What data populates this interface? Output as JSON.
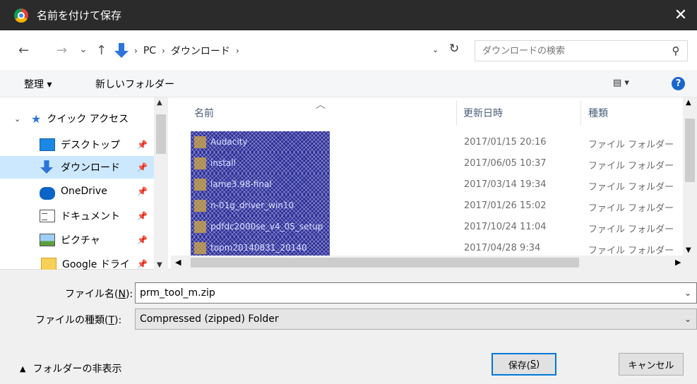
{
  "window": {
    "title": "名前を付けて保存",
    "close_label": "✕"
  },
  "nav": {
    "back": "←",
    "forward": "→",
    "recent": "⌄",
    "up": "↑",
    "breadcrumb": [
      "PC",
      "ダウンロード"
    ],
    "refresh": "↻",
    "search_placeholder": "ダウンロードの検索"
  },
  "toolbar": {
    "organize_label": "整理 ▾",
    "new_folder_label": "新しいフォルダー",
    "view_label": "▤ ▾",
    "help_label": "?"
  },
  "sidebar": {
    "items": [
      {
        "label": "クイック アクセス",
        "icon": "star-icon"
      },
      {
        "label": "デスクトップ",
        "icon": "desktop-icon"
      },
      {
        "label": "ダウンロード",
        "icon": "download-icon",
        "selected": true
      },
      {
        "label": "OneDrive",
        "icon": "onedrive-icon"
      },
      {
        "label": "ドキュメント",
        "icon": "document-icon"
      },
      {
        "label": "ピクチャ",
        "icon": "picture-icon"
      },
      {
        "label": "Google ドライ",
        "icon": "folder-icon"
      }
    ]
  },
  "filelist": {
    "columns": {
      "name": "名前",
      "modified": "更新日時",
      "type": "種類"
    },
    "rows": [
      {
        "name": "Audacity",
        "modified": "2017/01/15 20:16",
        "type": "ファイル フォルダー"
      },
      {
        "name": "install",
        "modified": "2017/06/05 10:37",
        "type": "ファイル フォルダー"
      },
      {
        "name": "lame3.98-final",
        "modified": "2017/03/14 19:34",
        "type": "ファイル フォルダー"
      },
      {
        "name": "n-01g_driver_win10",
        "modified": "2017/01/26 15:02",
        "type": "ファイル フォルダー"
      },
      {
        "name": "pdfdc2000se_v4_05_setup",
        "modified": "2017/10/24 11:04",
        "type": "ファイル フォルダー"
      },
      {
        "name": "topm20140831_20140",
        "modified": "2017/04/28 9:34",
        "type": "ファイル フォルダー"
      }
    ]
  },
  "form": {
    "filename_label": "ファイル名(",
    "filename_key": "N",
    "filename_label_end": "):",
    "filename_value": "prm_tool_m.zip",
    "filetype_label": "ファイルの種類(",
    "filetype_key": "T",
    "filetype_label_end": "):",
    "filetype_value": "Compressed (zipped) Folder"
  },
  "footer": {
    "hide_folders_label": "フォルダーの非表示",
    "save_label": "保存(",
    "save_key": "S",
    "save_end": ")",
    "cancel_label": "キャンセル"
  }
}
